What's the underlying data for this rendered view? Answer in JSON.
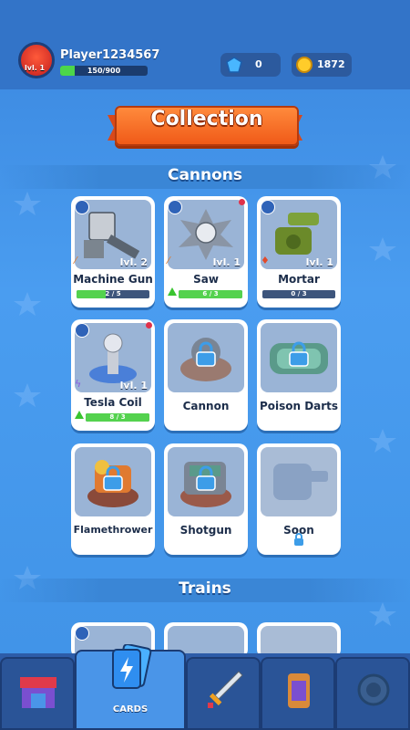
{
  "player": {
    "name": "Player1234567",
    "level": "lvl. 1",
    "xp_text": "150/900",
    "xp_fraction": 0.1667
  },
  "resources": {
    "gems": "0",
    "coins": "1872"
  },
  "title": "Collection",
  "sections": {
    "cannons": "Cannons",
    "trains": "Trains"
  },
  "cards": [
    {
      "name": "Machine Gun",
      "level": "lvl. 2",
      "progress": "2 / 5",
      "fraction": 0.4,
      "upgrade": false,
      "dot": false
    },
    {
      "name": "Saw",
      "level": "lvl. 1",
      "progress": "6 / 3",
      "fraction": 1.0,
      "upgrade": true,
      "dot": true
    },
    {
      "name": "Mortar",
      "level": "lvl. 1",
      "progress": "0 / 3",
      "fraction": 0,
      "upgrade": false,
      "dot": false
    },
    {
      "name": "Tesla Coil",
      "level": "lvl. 1",
      "progress": "8 / 3",
      "fraction": 1.0,
      "upgrade": true,
      "dot": true
    },
    {
      "name": "Cannon"
    },
    {
      "name": "Poison Darts"
    },
    {
      "name": "Flamethrower"
    },
    {
      "name": "Shotgun"
    },
    {
      "name": "Soon"
    }
  ],
  "nav": {
    "cards_label": "CARDS"
  },
  "colors": {
    "accent": "#f05a18",
    "bar_green": "#54d24e",
    "background": "#3d8fe0"
  }
}
